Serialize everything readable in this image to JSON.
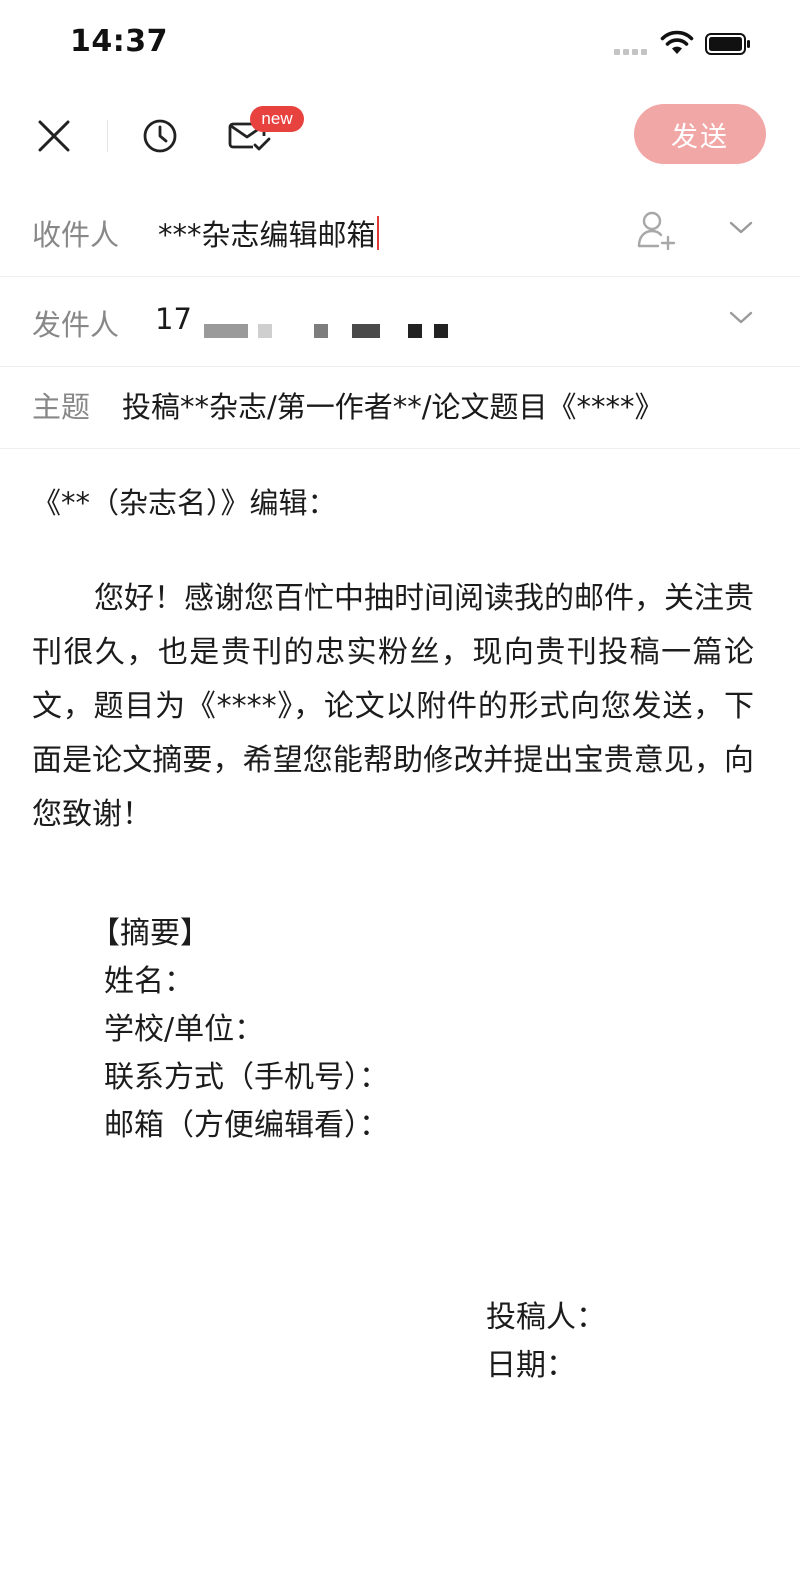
{
  "status_bar": {
    "time": "14:37"
  },
  "toolbar": {
    "badge": "new",
    "send_label": "发送"
  },
  "recipient": {
    "label": "收件人",
    "value": "***杂志编辑邮箱"
  },
  "sender": {
    "label": "发件人",
    "value": "17"
  },
  "subject": {
    "label": "主题",
    "value": "投稿**杂志/第一作者**/论文题目《****》"
  },
  "body": {
    "greeting": "《**（杂志名）》编辑：",
    "paragraph": "您好！感谢您百忙中抽时间阅读我的邮件，关注贵刊很久，也是贵刊的忠实粉丝，现向贵刊投稿一篇论文，题目为《****》，论文以附件的形式向您发送，下面是论文摘要，希望您能帮助修改并提出宝贵意见，向您致谢！",
    "abstract_heading": "【摘要】",
    "abstract_items": [
      "姓名：",
      "学校/单位：",
      "联系方式（手机号）：",
      "邮箱（方便编辑看）："
    ],
    "signer": "投稿人：",
    "date": "日期："
  },
  "colors": {
    "accent": "#e8423f",
    "send_button_bg": "#f2a7a7",
    "label_gray": "#888888"
  }
}
